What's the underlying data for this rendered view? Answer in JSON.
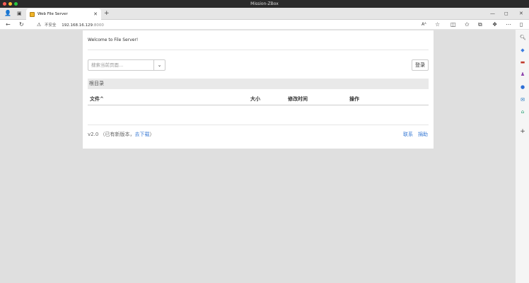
{
  "window": {
    "title": "Mission-ZBox"
  },
  "tab": {
    "title": "Web File Server"
  },
  "address": {
    "insecure_label": "不安全",
    "host": "192.168.16.129",
    "port": ":8000"
  },
  "page": {
    "welcome": "Welcome to File Server!",
    "search_placeholder": "搜索当前页面...",
    "login": "登录",
    "breadcrumb": "根目录",
    "columns": {
      "file": "文件^",
      "size": "大小",
      "modified": "修改时间",
      "actions": "操作"
    },
    "footer": {
      "version": "v2.0",
      "paren_open": "（已有新版本，",
      "download": "去下载",
      "paren_close": "）",
      "contact": "联系",
      "donate": "捐助"
    }
  },
  "colors": {
    "accent": "#3a7bd5",
    "background": "#dfdfdf"
  }
}
